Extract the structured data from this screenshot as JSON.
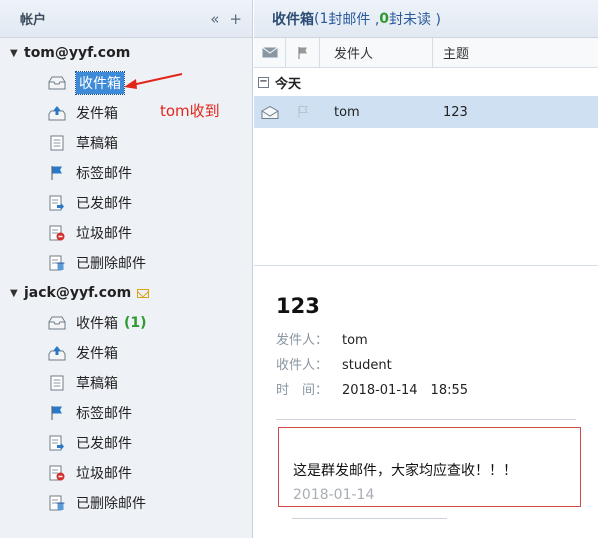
{
  "left": {
    "header": "帐户",
    "collapse_glyph": "«",
    "add_glyph": "+",
    "accounts": [
      {
        "name": "tom@yyf.com",
        "folders": [
          {
            "label": "收件箱",
            "count": "",
            "icon": "inbox-icon"
          },
          {
            "label": "发件箱",
            "count": "",
            "icon": "outbox-icon"
          },
          {
            "label": "草稿箱",
            "count": "",
            "icon": "drafts-icon"
          },
          {
            "label": "标签邮件",
            "count": "",
            "icon": "flag-icon"
          },
          {
            "label": "已发邮件",
            "count": "",
            "icon": "sent-icon"
          },
          {
            "label": "垃圾邮件",
            "count": "",
            "icon": "junk-icon"
          },
          {
            "label": "已删除邮件",
            "count": "",
            "icon": "trash-icon"
          }
        ]
      },
      {
        "name": "jack@yyf.com",
        "folders": [
          {
            "label": "收件箱",
            "count": "(1)",
            "icon": "inbox-icon"
          },
          {
            "label": "发件箱",
            "count": "",
            "icon": "outbox-icon"
          },
          {
            "label": "草稿箱",
            "count": "",
            "icon": "drafts-icon"
          },
          {
            "label": "标签邮件",
            "count": "",
            "icon": "flag-icon"
          },
          {
            "label": "已发邮件",
            "count": "",
            "icon": "sent-icon"
          },
          {
            "label": "垃圾邮件",
            "count": "",
            "icon": "junk-icon"
          },
          {
            "label": "已删除邮件",
            "count": "",
            "icon": "trash-icon"
          }
        ]
      }
    ],
    "annotation": "tom收到"
  },
  "right": {
    "header": {
      "folder": "收件箱",
      "p1": " ( ",
      "total": "1",
      "p2": " 封邮件 , ",
      "unread": "0",
      "p3": " 封未读 )"
    },
    "columns": {
      "sender": "发件人",
      "subject": "主题"
    },
    "group": "今天",
    "row": {
      "sender": "tom",
      "subject": "123"
    },
    "preview": {
      "subject": "123",
      "from_label": "发件人：",
      "from": "tom",
      "to_label": "收件人：",
      "to": "student",
      "time_label": "时　间：",
      "time": "2018-01-14　18:55",
      "body": "这是群发邮件，大家均应查收！！！",
      "date": "2018-01-14"
    }
  },
  "colors": {
    "accent": "#3d8bd8",
    "annotation": "#e2251a",
    "unread_green": "#2f9a2f"
  }
}
